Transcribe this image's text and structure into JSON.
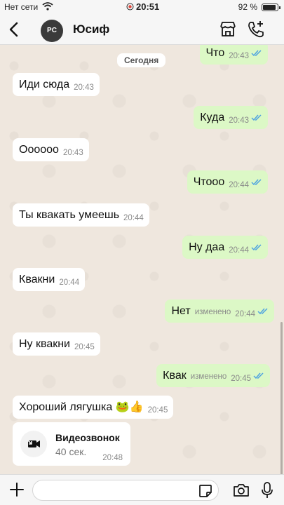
{
  "status_bar": {
    "carrier": "Нет сети",
    "time": "20:51",
    "battery": "92 %"
  },
  "header": {
    "avatar_text": "PC",
    "contact_name": "Юсиф"
  },
  "chat": {
    "date_label": "Сегодня",
    "messages": [
      {
        "dir": "out",
        "text": "Что",
        "time": "20:43",
        "edited": ""
      },
      {
        "dir": "in",
        "text": "Иди сюда",
        "time": "20:43",
        "edited": ""
      },
      {
        "dir": "out",
        "text": "Куда",
        "time": "20:43",
        "edited": ""
      },
      {
        "dir": "in",
        "text": "Оооооо",
        "time": "20:43",
        "edited": ""
      },
      {
        "dir": "out",
        "text": "Чтооо",
        "time": "20:44",
        "edited": ""
      },
      {
        "dir": "in",
        "text": "Ты квакать умеешь",
        "time": "20:44",
        "edited": ""
      },
      {
        "dir": "out",
        "text": "Ну даа",
        "time": "20:44",
        "edited": ""
      },
      {
        "dir": "in",
        "text": "Квакни",
        "time": "20:44",
        "edited": ""
      },
      {
        "dir": "out",
        "text": "Нет",
        "time": "20:44",
        "edited": "изменено"
      },
      {
        "dir": "in",
        "text": "Ну квакни",
        "time": "20:45",
        "edited": ""
      },
      {
        "dir": "out",
        "text": "Квак",
        "time": "20:45",
        "edited": "изменено"
      },
      {
        "dir": "in",
        "text": "Хороший лягушка 🐸👍",
        "time": "20:45",
        "edited": ""
      }
    ],
    "video_call": {
      "title": "Видеозвонок",
      "duration": "40 сек.",
      "time": "20:48"
    }
  },
  "input": {
    "placeholder": ""
  },
  "colors": {
    "incoming": "#ffffff",
    "outgoing": "#dcf8c6",
    "read_ticks": "#4fa3e0"
  }
}
